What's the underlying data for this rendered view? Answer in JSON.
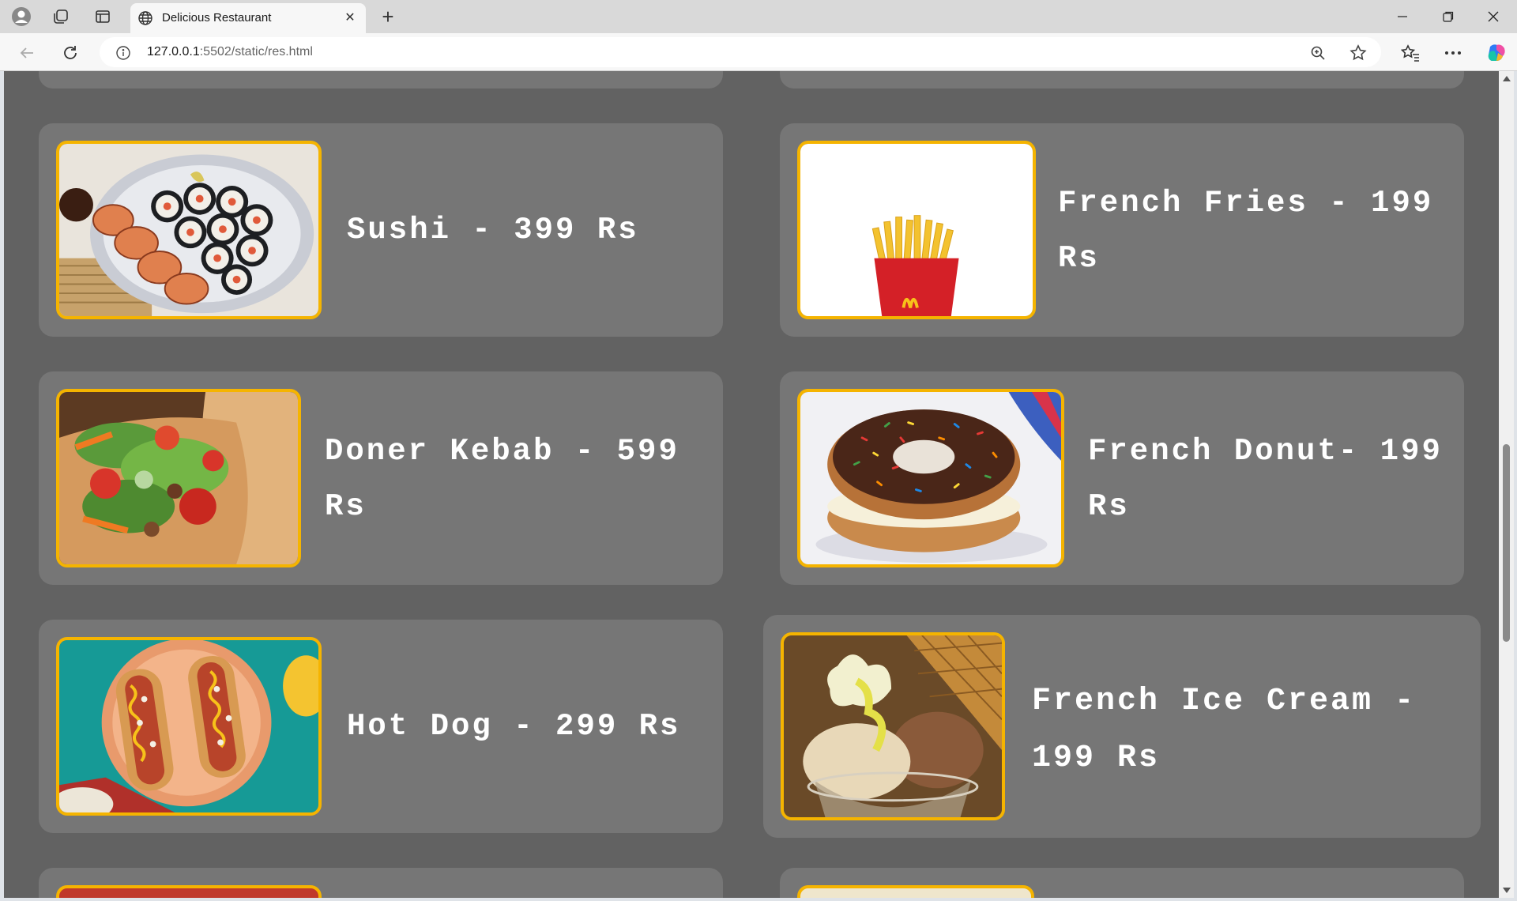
{
  "browser": {
    "tab_title": "Delicious Restaurant",
    "url_host": "127.0.0.1",
    "url_rest": ":5502/static/res.html"
  },
  "menu": {
    "items": [
      {
        "text": "Sushi - 399 Rs",
        "image": "sushi-platter"
      },
      {
        "text": "French Fries - 199 Rs",
        "image": "french-fries"
      },
      {
        "text": "Doner Kebab - 599 Rs",
        "image": "doner-kebab"
      },
      {
        "text": "French Donut- 199 Rs",
        "image": "sprinkled-donut"
      },
      {
        "text": "Hot Dog - 299 Rs",
        "image": "hot-dogs"
      },
      {
        "text": "French Ice Cream - 199 Rs",
        "image": "ice-cream-sundae"
      }
    ]
  },
  "colors": {
    "page_bg": "#626262",
    "card_bg": "#767676",
    "image_border": "#f5b400",
    "text": "#ffffff"
  }
}
